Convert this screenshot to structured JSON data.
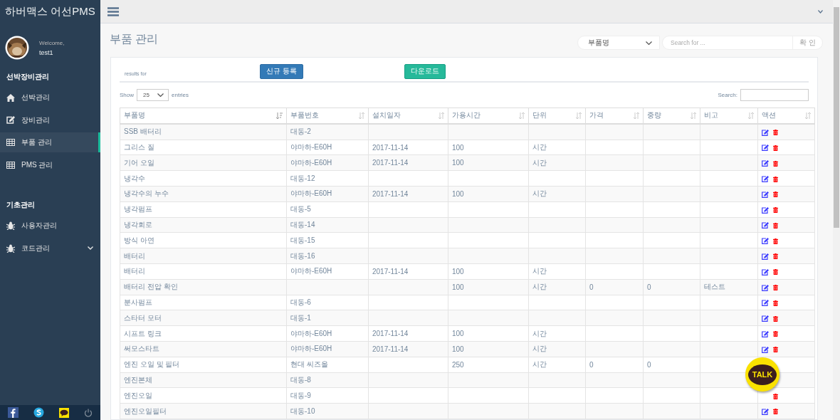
{
  "sidebar": {
    "brand": "하버맥스 어선PMS",
    "welcome": "Welcome,",
    "user": "test1",
    "sections": [
      {
        "title": "선박장비관리",
        "items": [
          {
            "label": "선박관리",
            "selected": false,
            "expandable": false
          },
          {
            "label": "장비관리",
            "selected": false,
            "expandable": false
          },
          {
            "label": "부품 관리",
            "selected": true,
            "expandable": false
          },
          {
            "label": "PMS 관리",
            "selected": false,
            "expandable": false
          }
        ]
      },
      {
        "title": "기초관리",
        "items": [
          {
            "label": "사용자관리",
            "selected": false,
            "expandable": false
          },
          {
            "label": "코드관리",
            "selected": false,
            "expandable": true
          }
        ]
      }
    ]
  },
  "page_title": "부품 관리",
  "filter": {
    "select": "부품명",
    "search_placeholder": "Search for ...",
    "confirm": "확 인"
  },
  "toolbar": {
    "results_label": "results for",
    "new_button": "신규 등록",
    "download_button": "다운로드"
  },
  "length": {
    "show": "Show",
    "value": "25",
    "entries": "entries"
  },
  "search_label": "Search:",
  "table": {
    "columns": [
      "부품명",
      "부품번호",
      "설치일자",
      "가용시간",
      "단위",
      "가격",
      "중량",
      "비고",
      "액션"
    ],
    "rows": [
      [
        "SSB 배터리",
        "대동-2",
        "",
        "",
        "",
        "",
        "",
        ""
      ],
      [
        "그리스 질",
        "야마하-E60H",
        "2017-11-14",
        "100",
        "시간",
        "",
        "",
        ""
      ],
      [
        "기어 오일",
        "야마하-E60H",
        "2017-11-14",
        "100",
        "시간",
        "",
        "",
        ""
      ],
      [
        "냉각수",
        "대동-12",
        "",
        "",
        "",
        "",
        "",
        ""
      ],
      [
        "냉각수의 누수",
        "야마하-E60H",
        "2017-11-14",
        "100",
        "시간",
        "",
        "",
        ""
      ],
      [
        "냉각펌프",
        "대동-5",
        "",
        "",
        "",
        "",
        "",
        ""
      ],
      [
        "냉각회로",
        "대동-14",
        "",
        "",
        "",
        "",
        "",
        ""
      ],
      [
        "방식 아연",
        "대동-15",
        "",
        "",
        "",
        "",
        "",
        ""
      ],
      [
        "배터리",
        "대동-16",
        "",
        "",
        "",
        "",
        "",
        ""
      ],
      [
        "배터리",
        "야마하-E60H",
        "2017-11-14",
        "100",
        "시간",
        "",
        "",
        ""
      ],
      [
        "배터리 전압 확인",
        "",
        "",
        "100",
        "시간",
        "0",
        "0",
        "테스트"
      ],
      [
        "분사펌프",
        "대동-6",
        "",
        "",
        "",
        "",
        "",
        ""
      ],
      [
        "스타터 모터",
        "대동-1",
        "",
        "",
        "",
        "",
        "",
        ""
      ],
      [
        "시프트 링크",
        "야마하-E60H",
        "2017-11-14",
        "100",
        "시간",
        "",
        "",
        ""
      ],
      [
        "써모스타트",
        "야마하-E60H",
        "2017-11-14",
        "100",
        "시간",
        "",
        "",
        ""
      ],
      [
        "엔진 오일 및 필터",
        "현대 씨즈올",
        "",
        "250",
        "시간",
        "0",
        "0",
        ""
      ],
      [
        "엔진본체",
        "대동-8",
        "",
        "",
        "",
        "",
        "",
        ""
      ],
      [
        "엔진오일",
        "대동-9",
        "",
        "",
        "",
        "",
        "",
        ""
      ],
      [
        "엔진오일필터",
        "대동-10",
        "",
        "",
        "",
        "",
        "",
        ""
      ]
    ]
  },
  "chat_button": "TALK"
}
